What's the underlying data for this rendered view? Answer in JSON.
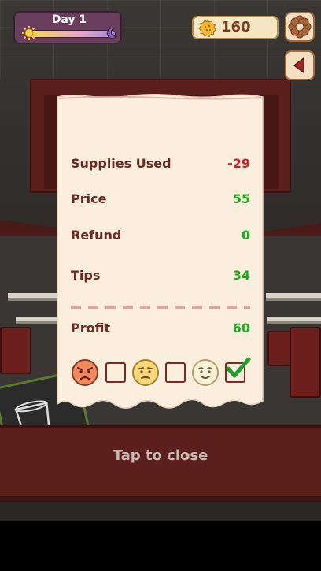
{
  "hud": {
    "day_label": "Day 1",
    "coins": "160"
  },
  "receipt": {
    "rows": [
      {
        "label": "Supplies Used",
        "value": "-29"
      },
      {
        "label": "Price",
        "value": "55"
      },
      {
        "label": "Refund",
        "value": "0"
      },
      {
        "label": "Tips",
        "value": "34"
      }
    ],
    "profit": {
      "label": "Profit",
      "value": "60"
    },
    "rating": {
      "faces": [
        "angry-face",
        "neutral-face",
        "happy-face"
      ],
      "selected_index": 2
    }
  },
  "footer": {
    "tap_to_close": "Tap to close"
  },
  "colors": {
    "negative": "#c0262a",
    "positive": "#1da81d",
    "label": "#6a2a24"
  }
}
